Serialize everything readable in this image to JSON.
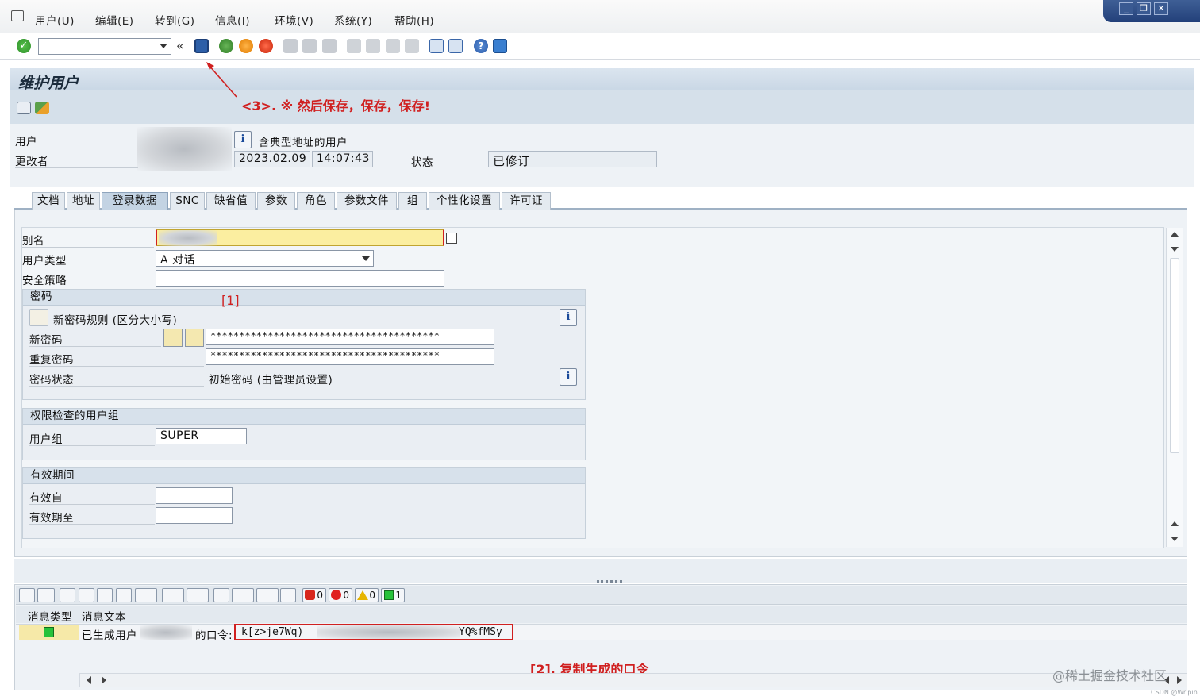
{
  "menu": {
    "items": [
      "用户(U)",
      "编辑(E)",
      "转到(G)",
      "信息(I)",
      "环境(V)",
      "系统(Y)",
      "帮助(H)"
    ]
  },
  "toolbar": {
    "command_value": "",
    "nav_back_glyph": "«"
  },
  "window_controls": {
    "minimize": "_",
    "restore": "❐",
    "close": "✕"
  },
  "page": {
    "title": "维护用户"
  },
  "annotations": {
    "save": "<3>. ※ 然后保存，保存，保存!",
    "one": "[1]",
    "two": "[2]. 复制生成的口令"
  },
  "header": {
    "user_label": "用户",
    "user_desc": "含典型地址的用户",
    "changed_by_label": "更改者",
    "date": "2023.02.09",
    "time": "14:07:43",
    "status_label": "状态",
    "status_value": "已修订"
  },
  "tabs": [
    "文档",
    "地址",
    "登录数据",
    "SNC",
    "缺省值",
    "参数",
    "角色",
    "参数文件",
    "组",
    "个性化设置",
    "许可证"
  ],
  "active_tab": "登录数据",
  "logon": {
    "alias_label": "别名",
    "user_type_label": "用户类型",
    "user_type_value": "A  对话",
    "security_policy_label": "安全策略",
    "password_group": "密码",
    "password_rule": "新密码规则 (区分大小写)",
    "new_password_label": "新密码",
    "new_password_value": "****************************************",
    "repeat_password_label": "重复密码",
    "repeat_password_value": "****************************************",
    "password_status_label": "密码状态",
    "password_status_value": "初始密码 (由管理员设置)",
    "auth_group_title": "权限检查的用户组",
    "user_group_label": "用户组",
    "user_group_value": "SUPER",
    "validity_title": "有效期间",
    "valid_from_label": "有效自",
    "valid_to_label": "有效期至"
  },
  "alv": {
    "stop_count": "0",
    "error_count": "0",
    "warning_count": "0",
    "success_count": "1",
    "col_type": "消息类型",
    "col_text": "消息文本",
    "row_text_prefix": "已生成用户",
    "row_text_mid": "的口令:",
    "pwd_start": "k[z>je7Wq)",
    "pwd_end": "YQ%fMSy"
  },
  "watermark": "@稀土掘金技术社区",
  "watermark_small": "CSDN @Wripin",
  "colors": {
    "accent": "#d02020",
    "alias_field": "#fbeea0",
    "success": "#27c23a"
  }
}
